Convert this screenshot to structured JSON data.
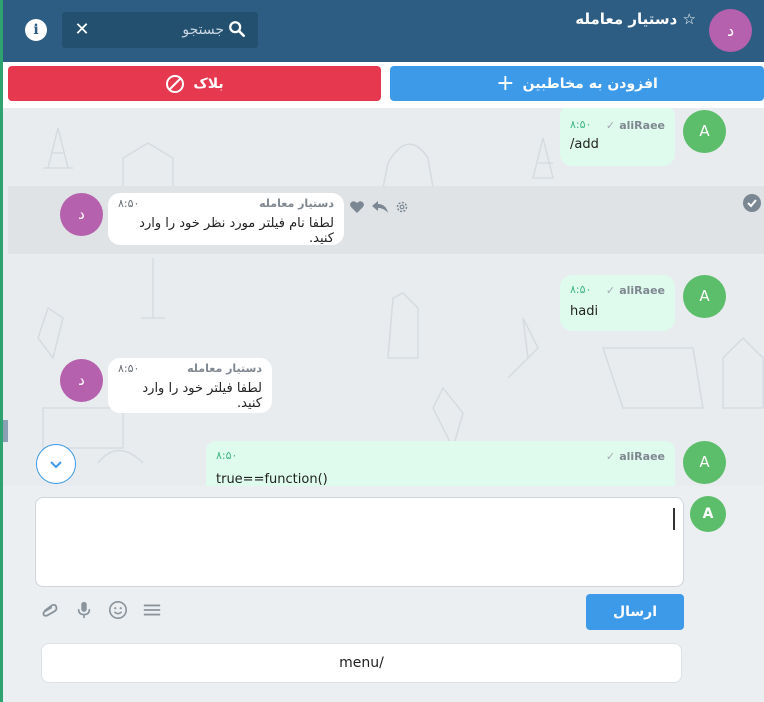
{
  "header": {
    "title": "دستیار معامله",
    "avatar_letter": "د",
    "info_label": "i",
    "search": {
      "placeholder": "جستجو",
      "value": ""
    }
  },
  "actions": {
    "block_label": "بلاک",
    "add_label": "افزودن به مخاطبین"
  },
  "messages": [
    {
      "sender": "aliRaee",
      "time": "۸:۵۰",
      "text": "/add",
      "avatar": "A",
      "direction": "out"
    },
    {
      "sender": "دستیار معامله",
      "time": "۸:۵۰",
      "text": "لطفا نام فیلتر مورد نظر خود را وارد کنید.",
      "avatar": "د",
      "direction": "in"
    },
    {
      "sender": "aliRaee",
      "time": "۸:۵۰",
      "text": "hadi",
      "avatar": "A",
      "direction": "out"
    },
    {
      "sender": "دستیار معامله",
      "time": "۸:۵۰",
      "text": "لطفا فیلتر خود را وارد کنید.",
      "avatar": "د",
      "direction": "in"
    },
    {
      "sender": "aliRaee",
      "time": "۸:۵۰",
      "text": "true==function()",
      "avatar": "A",
      "direction": "out"
    }
  ],
  "composer": {
    "avatar_letter": "A",
    "input_value": "",
    "send_label": "ارسال",
    "menu_chip": "menu/"
  },
  "colors": {
    "header_bg": "#2d5d82",
    "block_red": "#e63950",
    "primary_blue": "#3c9ae9",
    "out_bubble": "#defbee",
    "avatar_green": "#5cbd6a",
    "avatar_purple": "#b661ad"
  },
  "icons": [
    "info-icon",
    "close-icon",
    "search-icon",
    "star-icon",
    "block-icon",
    "plus-icon",
    "check-icon",
    "gear-icon",
    "reply-icon",
    "heart-icon",
    "chevron-down-icon",
    "attach-icon",
    "mic-icon",
    "emoji-icon",
    "menu-icon"
  ]
}
